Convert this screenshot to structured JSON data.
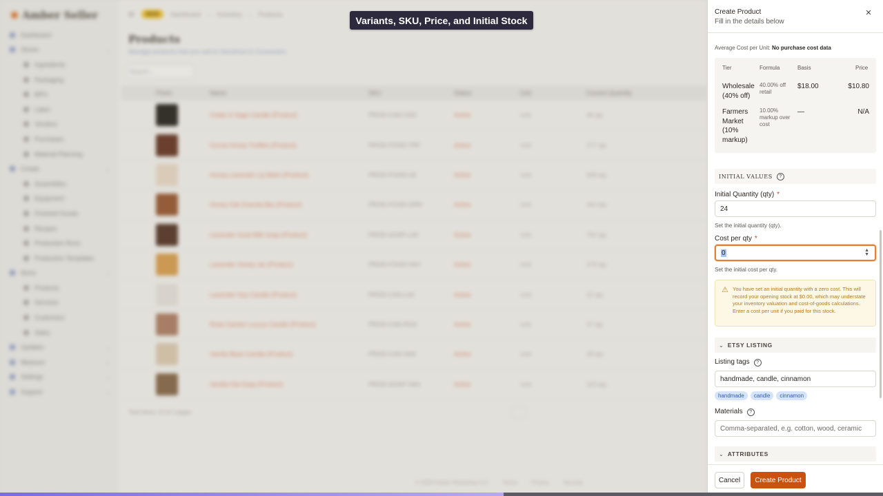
{
  "caption": "Variants, SKU, Price, and Initial Stock",
  "progress": 0.57,
  "background": {
    "brand": "Amber Seller",
    "nav": [
      {
        "label": "Dashboard",
        "sub": false
      },
      {
        "label": "Stores",
        "sub": false
      },
      {
        "label": "Ingredients",
        "sub": true
      },
      {
        "label": "Packaging",
        "sub": true
      },
      {
        "label": "BIPs",
        "sub": true
      },
      {
        "label": "Labor",
        "sub": true
      },
      {
        "label": "Vendors",
        "sub": true
      },
      {
        "label": "Purchases",
        "sub": true
      },
      {
        "label": "Material Planning",
        "sub": true
      },
      {
        "label": "Create",
        "sub": false
      },
      {
        "label": "Assemblies",
        "sub": true
      },
      {
        "label": "Equipment",
        "sub": true
      },
      {
        "label": "Finished Goods",
        "sub": true
      },
      {
        "label": "Recipes",
        "sub": true
      },
      {
        "label": "Production Runs",
        "sub": true
      },
      {
        "label": "Production Templates",
        "sub": true
      },
      {
        "label": "Items",
        "sub": false
      },
      {
        "label": "Products",
        "sub": true
      },
      {
        "label": "Services",
        "sub": true
      },
      {
        "label": "Customers",
        "sub": true
      },
      {
        "label": "Sales",
        "sub": true
      },
      {
        "label": "Updates",
        "sub": false
      },
      {
        "label": "Measure",
        "sub": false
      },
      {
        "label": "Settings",
        "sub": false
      },
      {
        "label": "Support",
        "sub": false
      }
    ],
    "breadcrumb": [
      "NEW",
      "Dashboard",
      "Inventory",
      "Products"
    ],
    "page_title": "Products",
    "page_subtitle": "Manage products that you sell to Storefront & Consumers",
    "search_placeholder": "Search...",
    "columns": [
      "Photo",
      "Name",
      "SKU",
      "Status",
      "Unit",
      "Current Quantity"
    ],
    "rows": [
      {
        "name": "Cedar & Sage Candle (Product)",
        "sku": "PROD-CAN-CED",
        "status": "Active",
        "unit": "Unit",
        "qty": "48 qty",
        "thumb": "#2c2a22"
      },
      {
        "name": "Cocoa Honey Truffles (Product)",
        "sku": "PROD-FOOD-TRF",
        "status": "Active",
        "unit": "Unit",
        "qty": "277 qty",
        "thumb": "#6b3a26"
      },
      {
        "name": "Honey Lavender Lip Balm (Product)",
        "sku": "PROD-FOOD-LB",
        "status": "Active",
        "unit": "Unit",
        "qty": "608 qty",
        "thumb": "#e9d9c4"
      },
      {
        "name": "Honey Oat Granola Bar (Product)",
        "sku": "PROD-FOOD-GRN",
        "status": "Active",
        "unit": "Unit",
        "qty": "344 qty",
        "thumb": "#9a5b34"
      },
      {
        "name": "Lavender Goat Milk Soap (Product)",
        "sku": "PROD-SOAP-LAV",
        "status": "Active",
        "unit": "Unit",
        "qty": "750 qty",
        "thumb": "#5a3a2a"
      },
      {
        "name": "Lavender Honey Jar (Product)",
        "sku": "PROD-FOOD-HNY",
        "status": "Active",
        "unit": "Unit",
        "qty": "378 qty",
        "thumb": "#d9a050"
      },
      {
        "name": "Lavender Soy Candle (Product)",
        "sku": "PROD-CAN-LAV",
        "status": "Active",
        "unit": "Unit",
        "qty": "22 qty",
        "thumb": "#e6e1da"
      },
      {
        "name": "Rose Garden Luxury Candle (Product)",
        "sku": "PROD-CAN-ROS",
        "status": "Active",
        "unit": "Unit",
        "qty": "37 qty",
        "thumb": "#b08066"
      },
      {
        "name": "Vanilla Bean Candle (Product)",
        "sku": "PROD-CAN-VAN",
        "status": "Active",
        "unit": "Unit",
        "qty": "28 qty",
        "thumb": "#dccab0"
      },
      {
        "name": "Vanilla Oat Soap (Product)",
        "sku": "PROD-SOAP-VAN",
        "status": "Active",
        "unit": "Unit",
        "qty": "323 qty",
        "thumb": "#8a6a4a"
      }
    ],
    "table_footer": "Total Items: 10 of 1 pages",
    "footer_links": [
      "© 2025 Amber Workshop LLC",
      "Terms",
      "Privacy",
      "Security"
    ]
  },
  "panel": {
    "title": "Create Product",
    "subtitle": "Fill in the details below",
    "avg_cost_label": "Average Cost per Unit:",
    "avg_cost_value": "No purchase cost data",
    "tier_headers": {
      "tier": "Tier",
      "formula": "Formula",
      "basis": "Basis",
      "price": "Price"
    },
    "tiers": [
      {
        "tier": "Wholesale (40% off)",
        "formula": "40.00% off retail",
        "basis": "$18.00",
        "price": "$10.80"
      },
      {
        "tier": "Farmers Market (10% markup)",
        "formula": "10.00% markup over cost",
        "basis": "—",
        "price": "N/A"
      }
    ],
    "initial_values_heading": "INITIAL VALUES",
    "initial_qty_label": "Initial Quantity (qty)",
    "initial_qty_value": "24",
    "initial_qty_help": "Set the initial quantity (qty).",
    "cost_label": "Cost per qty",
    "cost_value": "0",
    "cost_help": "Set the initial cost per qty.",
    "warning": "You have set an initial quantity with a zero cost. This will record your opening stock at $0.00, which may understate your inventory valuation and cost-of-goods calculations. Enter a cost per unit if you paid for this stock.",
    "etsy_heading": "ETSY LISTING",
    "listing_tags_label": "Listing tags",
    "listing_tags_value": "handmade, candle, cinnamon",
    "tags": [
      "handmade",
      "candle",
      "cinnamon"
    ],
    "materials_label": "Materials",
    "materials_placeholder": "Comma-separated, e.g. cotton, wood, ceramic",
    "attributes_heading": "ATTRIBUTES",
    "cancel_label": "Cancel",
    "create_label": "Create Product",
    "required_mark": "*"
  },
  "colors": {
    "accent": "#c9520e",
    "focus": "#e0813a",
    "warning_bg": "#fdf8e6",
    "tag_bg": "#d5e4fa"
  },
  "icons": [
    "close-icon",
    "help-circle-icon",
    "warning-triangle-icon",
    "chevron-down-icon",
    "spinner-arrows-icon"
  ]
}
